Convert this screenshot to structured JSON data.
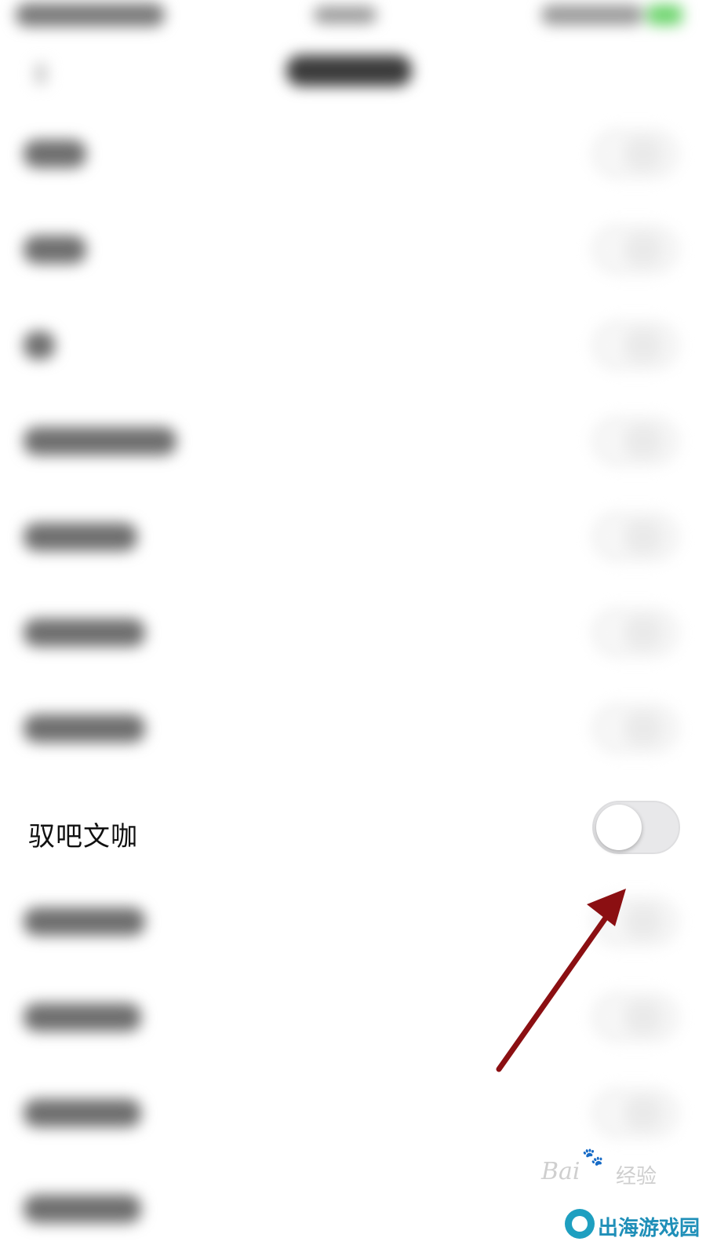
{
  "focused_setting": {
    "label": "驭吧文咖",
    "toggle_state": "off"
  },
  "watermarks": {
    "baidu_logo_text": "Bai",
    "baidu_jingyan": "经验",
    "site_name": "出海游戏园"
  },
  "colors": {
    "arrow": "#8b0f12",
    "toggle_off_track": "#e8e8ea",
    "site_brand": "#1e9fc0"
  },
  "icons": {
    "annotation_arrow": "arrow-icon",
    "baidu_paw": "paw-icon",
    "site_logo": "circle-logo-icon"
  }
}
